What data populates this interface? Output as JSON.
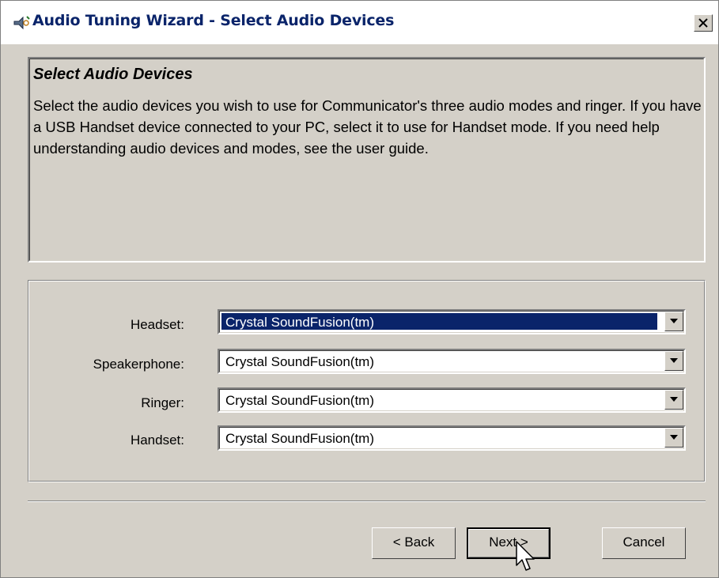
{
  "window": {
    "title": "Audio Tuning Wizard - Select Audio Devices",
    "icon": "audio-wizard-icon",
    "close_icon": "close-icon"
  },
  "info": {
    "heading": "Select Audio Devices",
    "description": "Select the audio devices you wish to use for Communicator's three audio modes and ringer. If you have a USB Handset device connected to your PC, select it to use for Handset mode. If you need help understanding audio devices and modes, see the user guide."
  },
  "devices": [
    {
      "label": "Headset:",
      "value": "Crystal SoundFusion(tm)",
      "selected": true
    },
    {
      "label": "Speakerphone:",
      "value": "Crystal SoundFusion(tm)",
      "selected": false
    },
    {
      "label": "Ringer:",
      "value": "Crystal SoundFusion(tm)",
      "selected": false
    },
    {
      "label": "Handset:",
      "value": "Crystal SoundFusion(tm)",
      "selected": false
    }
  ],
  "buttons": {
    "back": "< Back",
    "next": "Next >",
    "cancel": "Cancel"
  },
  "colors": {
    "dialog_bg": "#d4d0c8",
    "title_text": "#0a246a",
    "selection": "#0a246a"
  }
}
